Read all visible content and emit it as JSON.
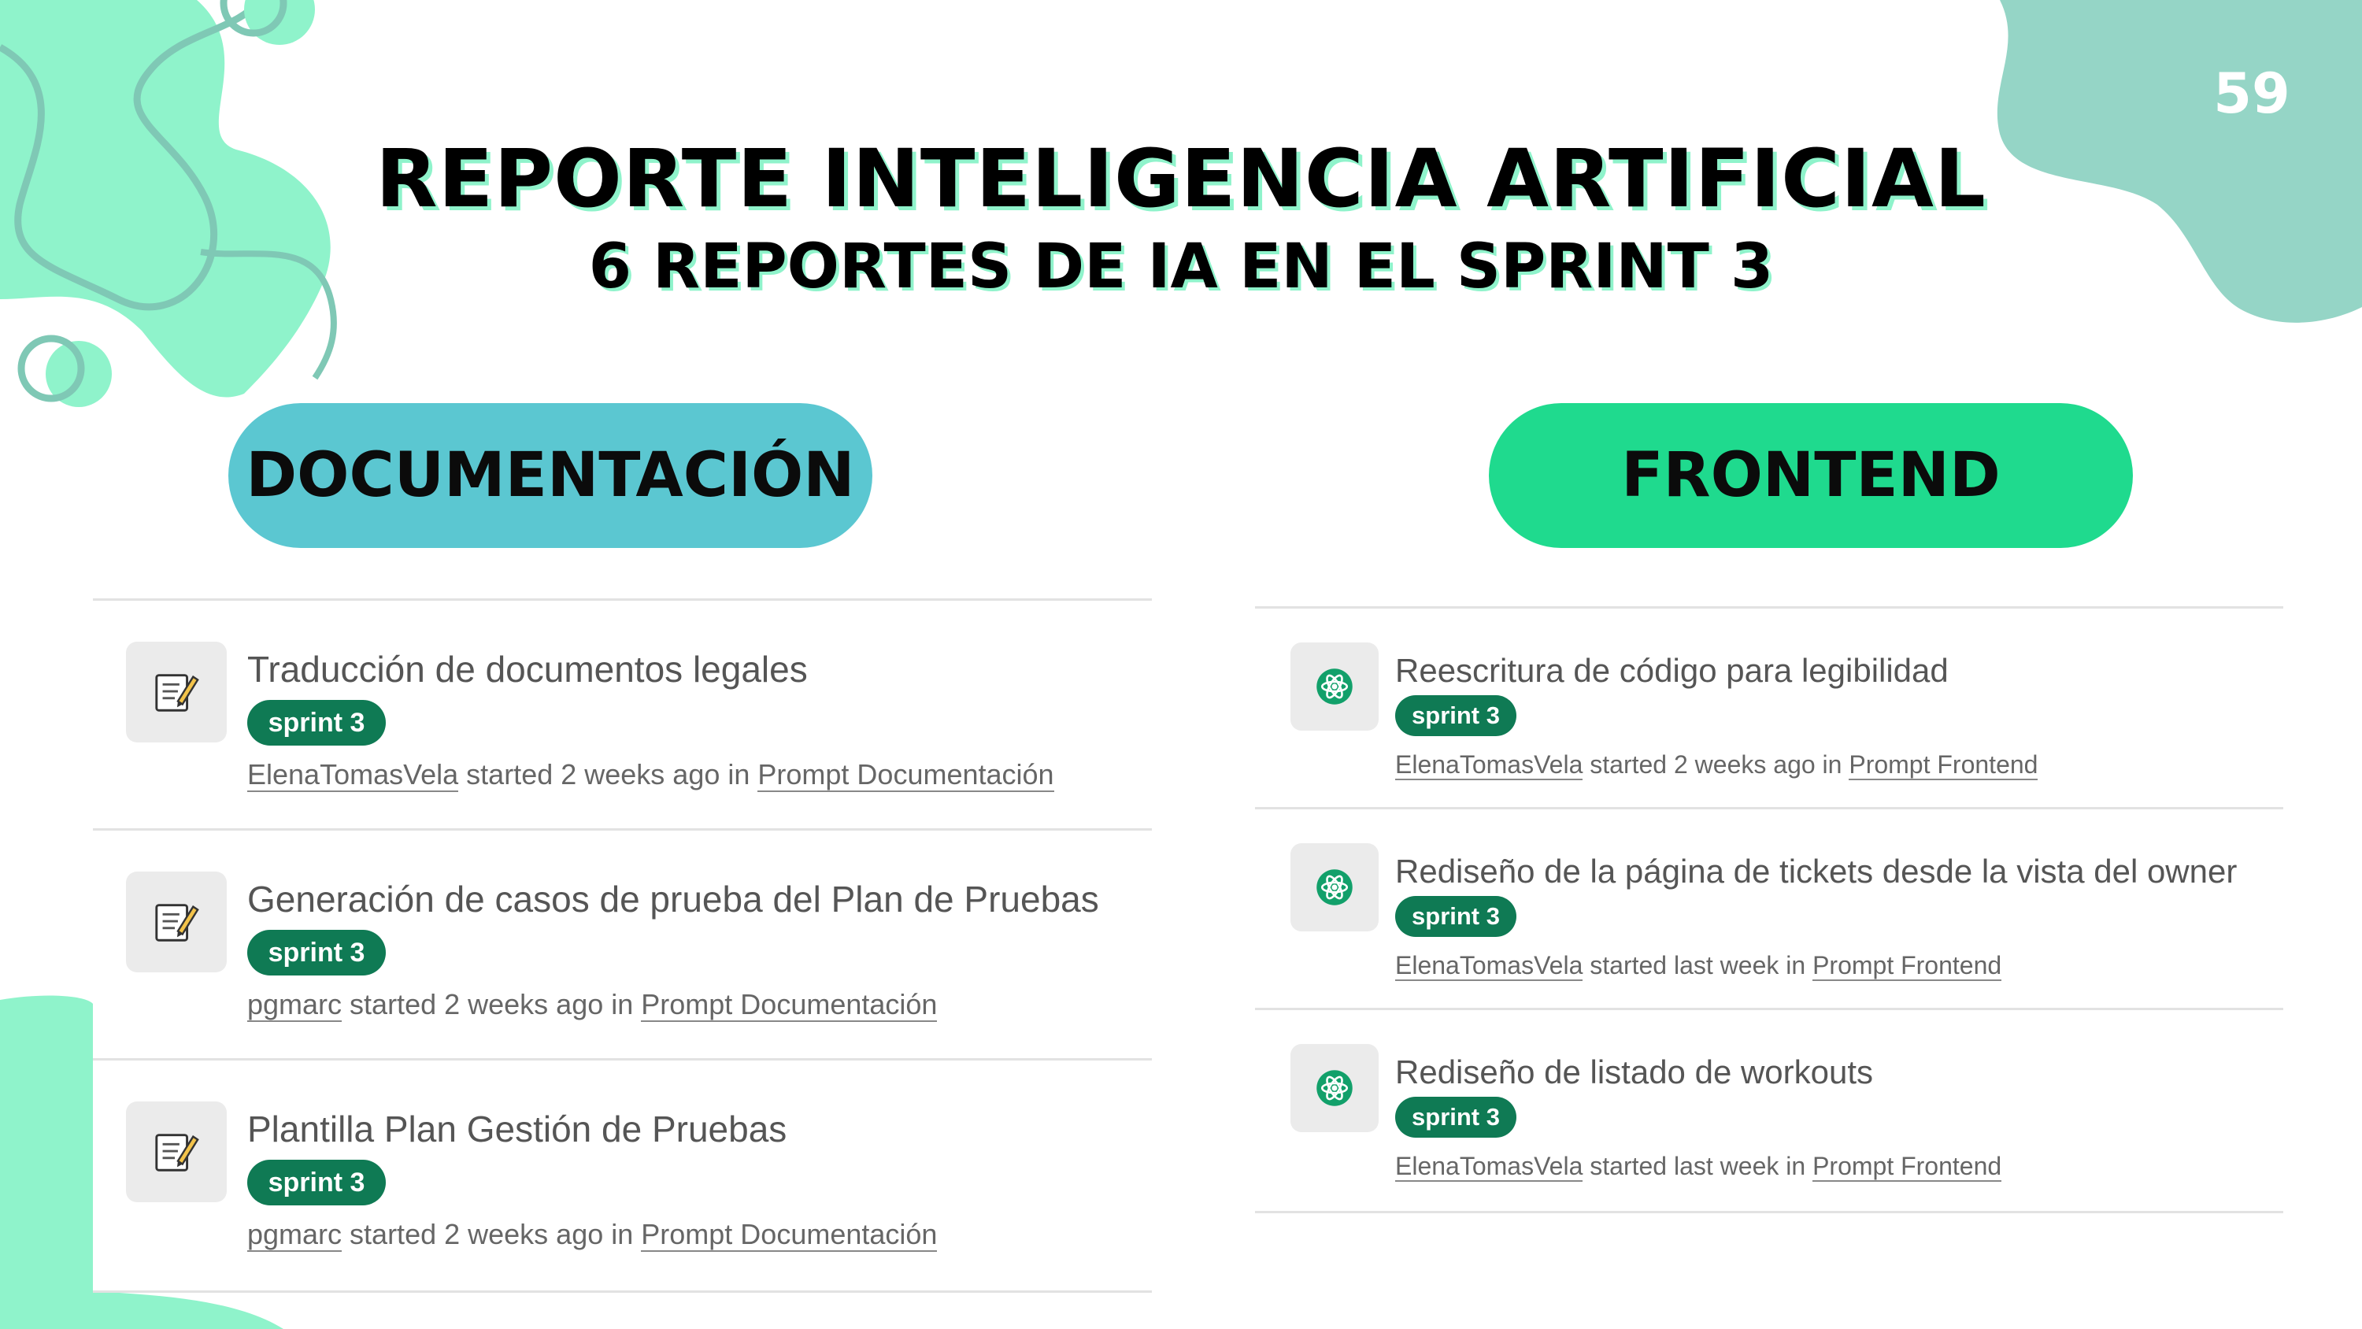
{
  "slide": {
    "page_number": "59",
    "title": "REPORTE INTELIGENCIA ARTIFICIAL",
    "subtitle": "6 REPORTES DE IA EN EL SPRINT 3"
  },
  "colors": {
    "doc_pill": "#5bc7d1",
    "frontend_pill": "#1fda8e",
    "badge": "#0f7a54",
    "decor_mint": "#8ff3cb",
    "decor_teal": "#95d5c6"
  },
  "sections": {
    "documentation": {
      "label": "DOCUMENTACIÓN",
      "icon": "memo-icon",
      "items": [
        {
          "title": "Traducción de documentos legales",
          "badge": "sprint 3",
          "author": "ElenaTomasVela",
          "when": " started 2 weeks ago in ",
          "project": "Prompt Documentación"
        },
        {
          "title": "Generación de casos de prueba del Plan de Pruebas",
          "badge": "sprint 3",
          "author": "pgmarc",
          "when": " started 2 weeks ago in ",
          "project": "Prompt Documentación"
        },
        {
          "title": "Plantilla Plan Gestión de Pruebas",
          "badge": "sprint 3",
          "author": "pgmarc",
          "when": " started 2 weeks ago in ",
          "project": "Prompt Documentación"
        }
      ]
    },
    "frontend": {
      "label": "FRONTEND",
      "icon": "atom-icon",
      "items": [
        {
          "title": "Reescritura de código para legibilidad",
          "badge": "sprint 3",
          "author": "ElenaTomasVela",
          "when": " started 2 weeks ago in ",
          "project": "Prompt Frontend"
        },
        {
          "title": "Rediseño de la página de tickets desde la vista del owner",
          "badge": "sprint 3",
          "author": "ElenaTomasVela",
          "when": " started last week in ",
          "project": "Prompt Frontend"
        },
        {
          "title": "Rediseño de listado de workouts",
          "badge": "sprint 3",
          "author": "ElenaTomasVela",
          "when": " started last week in ",
          "project": "Prompt Frontend"
        }
      ]
    }
  }
}
